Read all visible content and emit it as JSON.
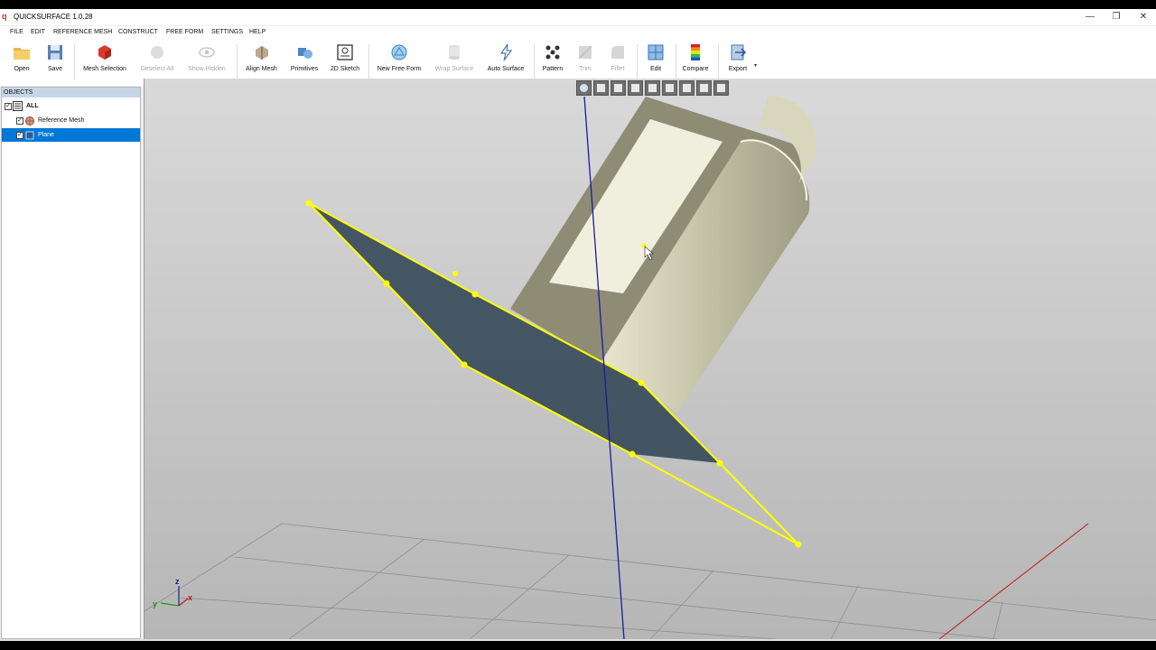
{
  "window": {
    "title": "QUICKSURFACE 1.0.28",
    "minimize": "—",
    "restore": "❐",
    "close": "✕"
  },
  "menu": [
    "FILE",
    "EDIT",
    "REFERENCE MESH",
    "CONSTRUCT",
    "FREE FORM",
    "SETTINGS",
    "HELP"
  ],
  "toolbar": {
    "open": "Open",
    "save": "Save",
    "mesh_selection": "Mesh Selection",
    "deselect_all": "Deselect All",
    "show_hidden": "Show Hidden",
    "align_mesh": "Align Mesh",
    "primitives": "Primitives",
    "sketch_2d": "2D Sketch",
    "new_free_form": "New Free Form",
    "wrap_surface": "Wrap Surface",
    "auto_surface": "Auto Surface",
    "pattern": "Pattern",
    "trim": "Trim",
    "fillet": "Fillet",
    "edit": "Edit",
    "compare": "Compare",
    "export": "Export"
  },
  "objects": {
    "header": "OBJECTS",
    "items": [
      {
        "label": "ALL",
        "checked": true
      },
      {
        "label": "Reference Mesh",
        "checked": true
      },
      {
        "label": "Plane",
        "checked": true,
        "selected": true
      }
    ]
  },
  "triad": {
    "z": "z",
    "y": "y",
    "x": "x"
  },
  "colors": {
    "selection": "#0078d7",
    "plane_fill": "#3f5260",
    "plane_edge": "#ffff00",
    "mesh": "#c9c7ad",
    "z_axis": "#1a1aa0",
    "x_axis": "#c01818"
  }
}
